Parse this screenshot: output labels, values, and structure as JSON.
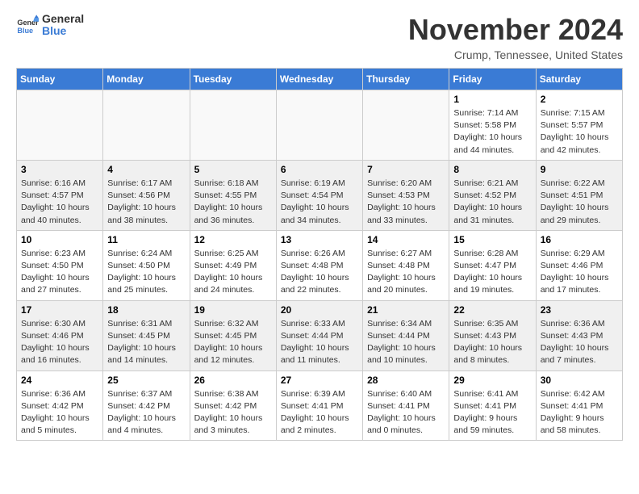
{
  "header": {
    "logo_general": "General",
    "logo_blue": "Blue",
    "title": "November 2024",
    "location": "Crump, Tennessee, United States"
  },
  "calendar": {
    "weekdays": [
      "Sunday",
      "Monday",
      "Tuesday",
      "Wednesday",
      "Thursday",
      "Friday",
      "Saturday"
    ],
    "weeks": [
      [
        {
          "day": "",
          "info": ""
        },
        {
          "day": "",
          "info": ""
        },
        {
          "day": "",
          "info": ""
        },
        {
          "day": "",
          "info": ""
        },
        {
          "day": "",
          "info": ""
        },
        {
          "day": "1",
          "info": "Sunrise: 7:14 AM\nSunset: 5:58 PM\nDaylight: 10 hours\nand 44 minutes."
        },
        {
          "day": "2",
          "info": "Sunrise: 7:15 AM\nSunset: 5:57 PM\nDaylight: 10 hours\nand 42 minutes."
        }
      ],
      [
        {
          "day": "3",
          "info": "Sunrise: 6:16 AM\nSunset: 4:57 PM\nDaylight: 10 hours\nand 40 minutes."
        },
        {
          "day": "4",
          "info": "Sunrise: 6:17 AM\nSunset: 4:56 PM\nDaylight: 10 hours\nand 38 minutes."
        },
        {
          "day": "5",
          "info": "Sunrise: 6:18 AM\nSunset: 4:55 PM\nDaylight: 10 hours\nand 36 minutes."
        },
        {
          "day": "6",
          "info": "Sunrise: 6:19 AM\nSunset: 4:54 PM\nDaylight: 10 hours\nand 34 minutes."
        },
        {
          "day": "7",
          "info": "Sunrise: 6:20 AM\nSunset: 4:53 PM\nDaylight: 10 hours\nand 33 minutes."
        },
        {
          "day": "8",
          "info": "Sunrise: 6:21 AM\nSunset: 4:52 PM\nDaylight: 10 hours\nand 31 minutes."
        },
        {
          "day": "9",
          "info": "Sunrise: 6:22 AM\nSunset: 4:51 PM\nDaylight: 10 hours\nand 29 minutes."
        }
      ],
      [
        {
          "day": "10",
          "info": "Sunrise: 6:23 AM\nSunset: 4:50 PM\nDaylight: 10 hours\nand 27 minutes."
        },
        {
          "day": "11",
          "info": "Sunrise: 6:24 AM\nSunset: 4:50 PM\nDaylight: 10 hours\nand 25 minutes."
        },
        {
          "day": "12",
          "info": "Sunrise: 6:25 AM\nSunset: 4:49 PM\nDaylight: 10 hours\nand 24 minutes."
        },
        {
          "day": "13",
          "info": "Sunrise: 6:26 AM\nSunset: 4:48 PM\nDaylight: 10 hours\nand 22 minutes."
        },
        {
          "day": "14",
          "info": "Sunrise: 6:27 AM\nSunset: 4:48 PM\nDaylight: 10 hours\nand 20 minutes."
        },
        {
          "day": "15",
          "info": "Sunrise: 6:28 AM\nSunset: 4:47 PM\nDaylight: 10 hours\nand 19 minutes."
        },
        {
          "day": "16",
          "info": "Sunrise: 6:29 AM\nSunset: 4:46 PM\nDaylight: 10 hours\nand 17 minutes."
        }
      ],
      [
        {
          "day": "17",
          "info": "Sunrise: 6:30 AM\nSunset: 4:46 PM\nDaylight: 10 hours\nand 16 minutes."
        },
        {
          "day": "18",
          "info": "Sunrise: 6:31 AM\nSunset: 4:45 PM\nDaylight: 10 hours\nand 14 minutes."
        },
        {
          "day": "19",
          "info": "Sunrise: 6:32 AM\nSunset: 4:45 PM\nDaylight: 10 hours\nand 12 minutes."
        },
        {
          "day": "20",
          "info": "Sunrise: 6:33 AM\nSunset: 4:44 PM\nDaylight: 10 hours\nand 11 minutes."
        },
        {
          "day": "21",
          "info": "Sunrise: 6:34 AM\nSunset: 4:44 PM\nDaylight: 10 hours\nand 10 minutes."
        },
        {
          "day": "22",
          "info": "Sunrise: 6:35 AM\nSunset: 4:43 PM\nDaylight: 10 hours\nand 8 minutes."
        },
        {
          "day": "23",
          "info": "Sunrise: 6:36 AM\nSunset: 4:43 PM\nDaylight: 10 hours\nand 7 minutes."
        }
      ],
      [
        {
          "day": "24",
          "info": "Sunrise: 6:36 AM\nSunset: 4:42 PM\nDaylight: 10 hours\nand 5 minutes."
        },
        {
          "day": "25",
          "info": "Sunrise: 6:37 AM\nSunset: 4:42 PM\nDaylight: 10 hours\nand 4 minutes."
        },
        {
          "day": "26",
          "info": "Sunrise: 6:38 AM\nSunset: 4:42 PM\nDaylight: 10 hours\nand 3 minutes."
        },
        {
          "day": "27",
          "info": "Sunrise: 6:39 AM\nSunset: 4:41 PM\nDaylight: 10 hours\nand 2 minutes."
        },
        {
          "day": "28",
          "info": "Sunrise: 6:40 AM\nSunset: 4:41 PM\nDaylight: 10 hours\nand 0 minutes."
        },
        {
          "day": "29",
          "info": "Sunrise: 6:41 AM\nSunset: 4:41 PM\nDaylight: 9 hours\nand 59 minutes."
        },
        {
          "day": "30",
          "info": "Sunrise: 6:42 AM\nSunset: 4:41 PM\nDaylight: 9 hours\nand 58 minutes."
        }
      ]
    ]
  }
}
